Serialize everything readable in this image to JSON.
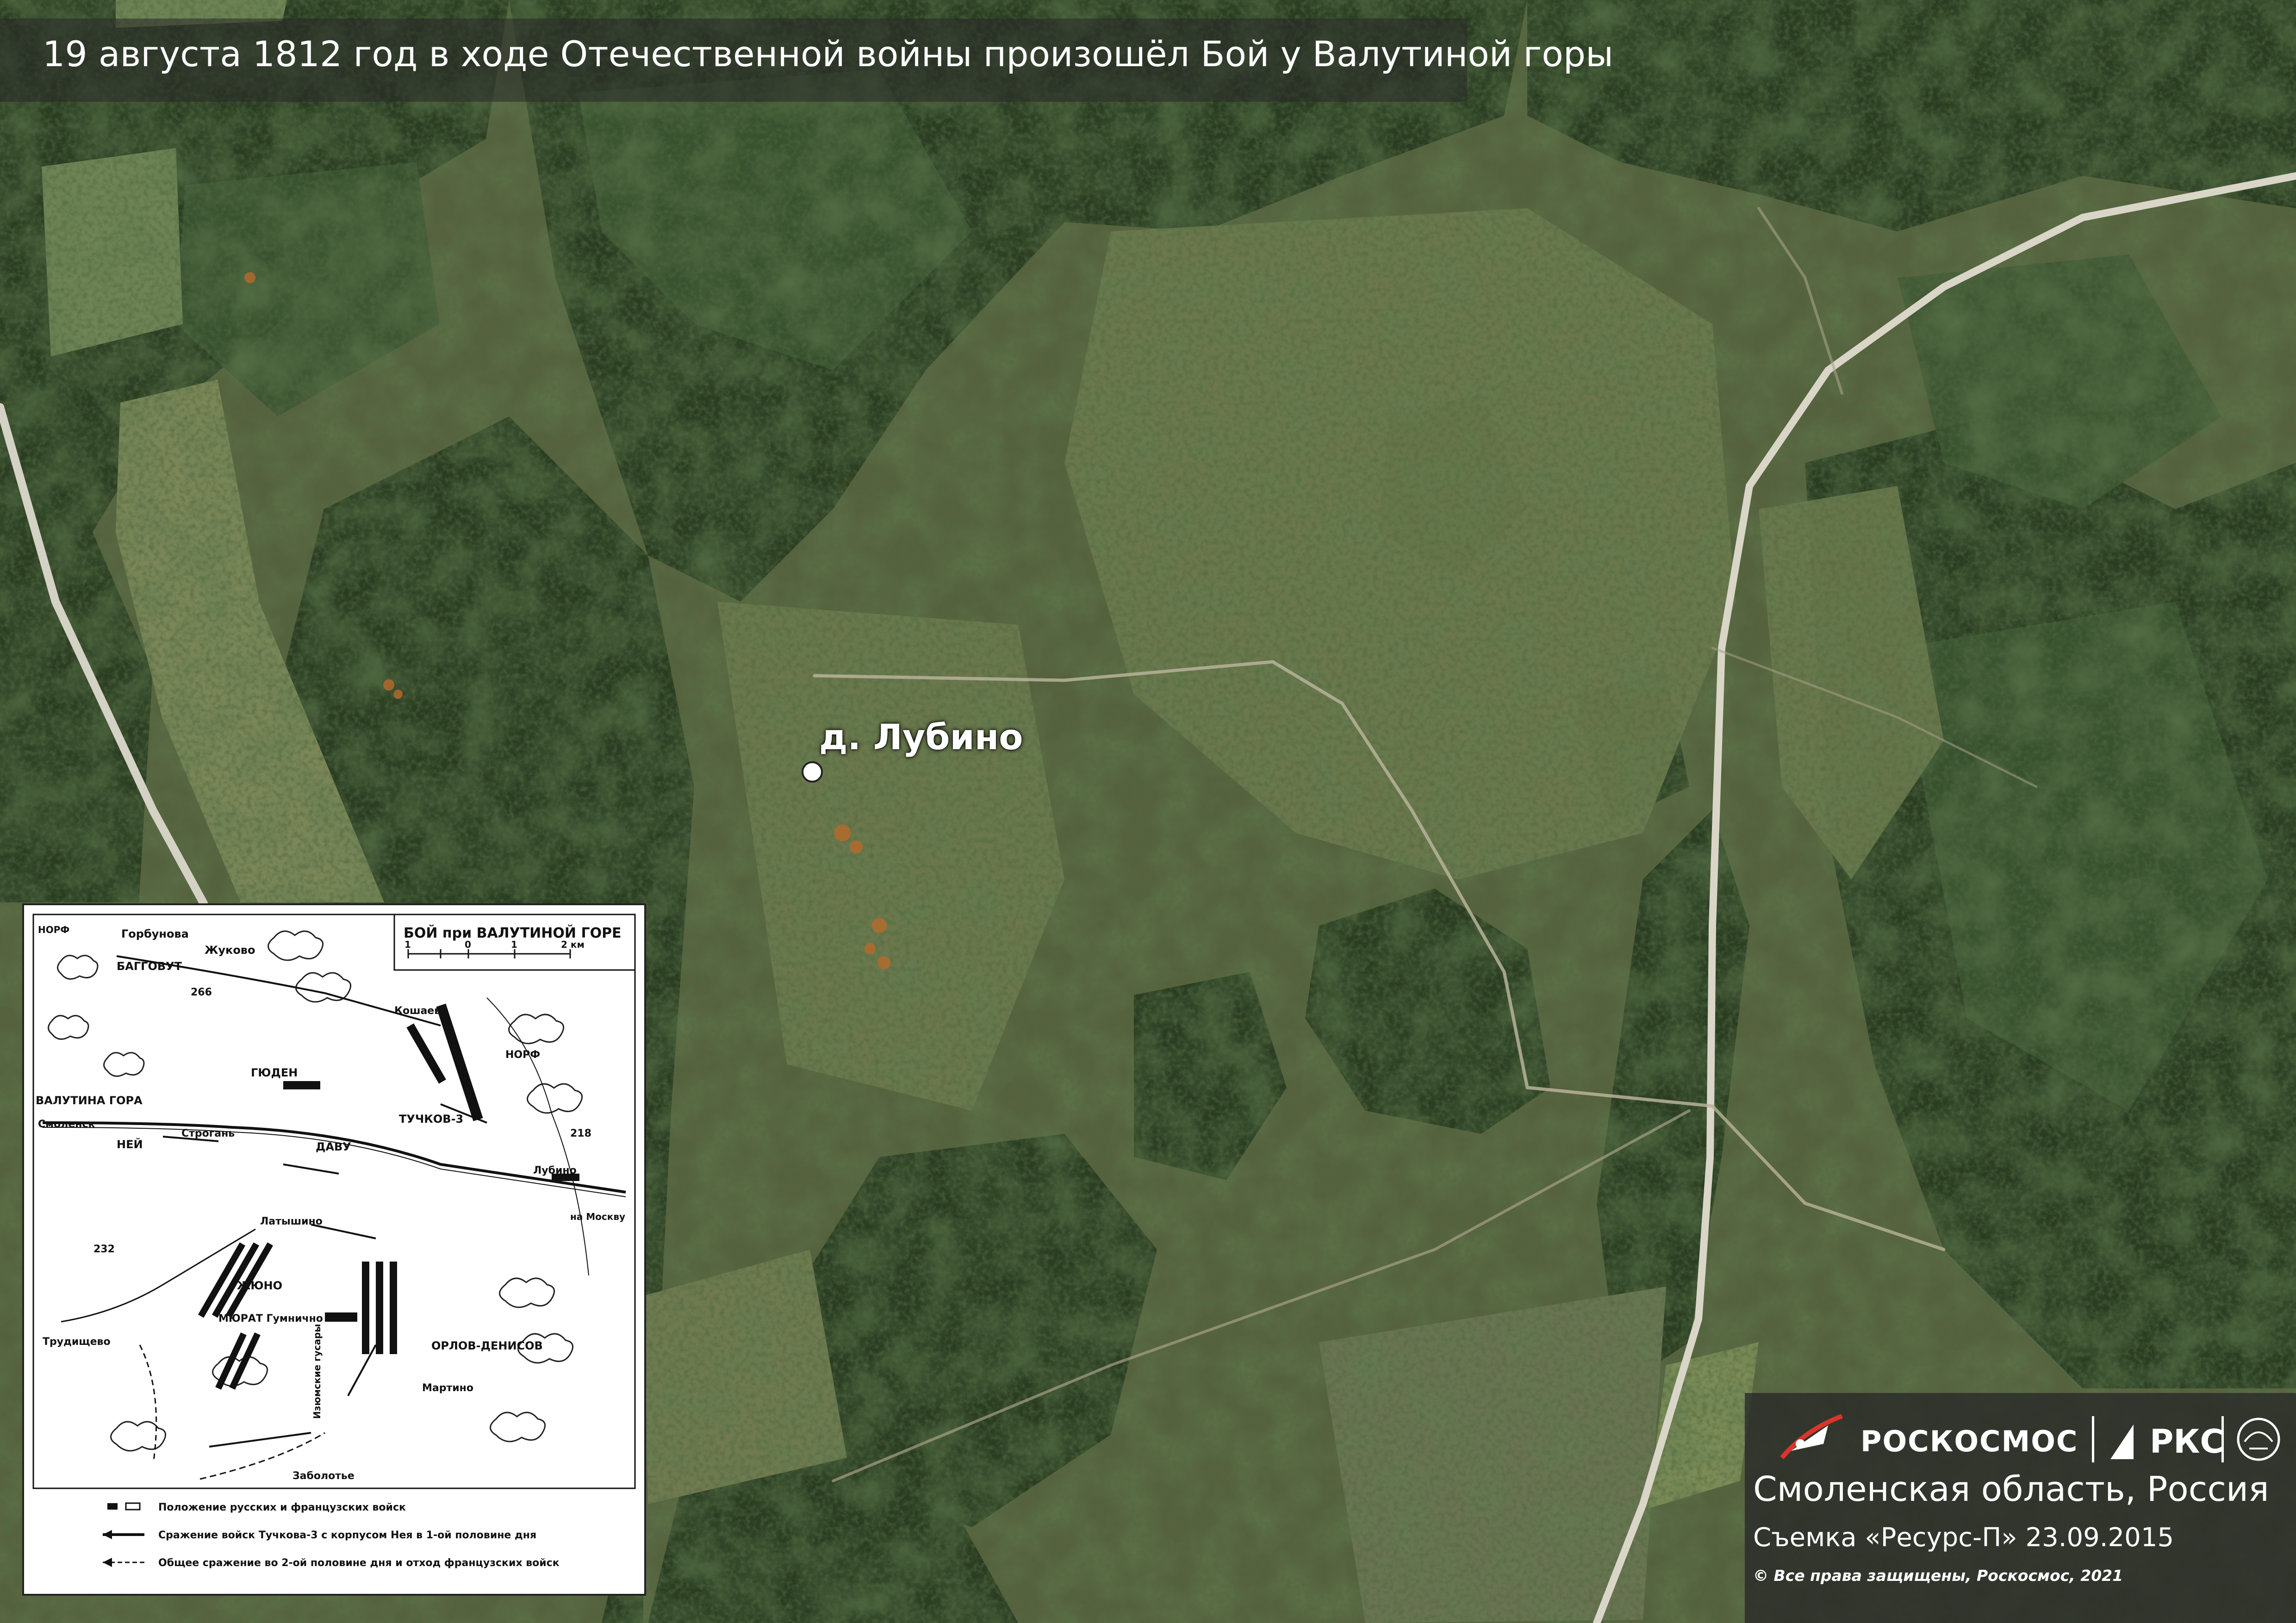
{
  "title": "19 августа 1812 год в ходе Отечественной войны произошёл Бой у Валутиной горы",
  "place_marker": {
    "label": "д. Лубино"
  },
  "inset_map": {
    "title": "БОЙ при ВАЛУТИНОЙ ГОРЕ",
    "scale": {
      "ticks": [
        "1",
        "0",
        "1",
        "2 км"
      ]
    },
    "labels": {
      "gorbunovo": "Горбунова",
      "zhukovo": "Жуково",
      "baggovut": "БАГГОВУТ",
      "norf_top": "НОРФ",
      "h266": "266",
      "koshaevo": "Кошаево",
      "gyuden": "ГЮДЕН",
      "valutina": "ВАЛУТИНА ГОРА",
      "smolensk": "Смоленск",
      "ney": "НЕЙ",
      "davu": "ДАВУ",
      "h218": "218",
      "lubino": "Лубино",
      "to_moscow": "на Москву",
      "latyshino": "Латышино",
      "h232": "232",
      "zhyuno": "ЖЮНО",
      "murat": "МЮРАТ Гумнично",
      "orlov": "ОРЛОВ-ДЕНИСОВ",
      "martino": "Мартино",
      "trudishchevo": "Трудищево",
      "zabolotye": "Заболотье",
      "izyum": "Изюмские гусары",
      "tuchkov": "ТУЧКОВ-3",
      "norf_right": "НОРФ",
      "strogan": "Строгань"
    },
    "legend": [
      "Положение русских и французских войск",
      "Сражение войск Тучкова-3 с корпусом Нея в 1-ой половине дня",
      "Общее сражение во 2-ой половине дня и отход французских войск"
    ]
  },
  "branding": {
    "roscosmos": "РОСКОСМОС",
    "rks": "РКС"
  },
  "caption": {
    "region": "Смоленская область, Россия",
    "shot": "Съемка «Ресурс-П» 23.09.2015",
    "rights": "© Все права защищены, Роскосмос, 2021"
  },
  "colors": {
    "forest_dark": "#263a1f",
    "forest_mid": "#3d5430",
    "meadow": "#6f7a4e",
    "field_light": "#8a9468",
    "road": "#d9d6c8",
    "panel_bg": "#2b2b2b"
  }
}
